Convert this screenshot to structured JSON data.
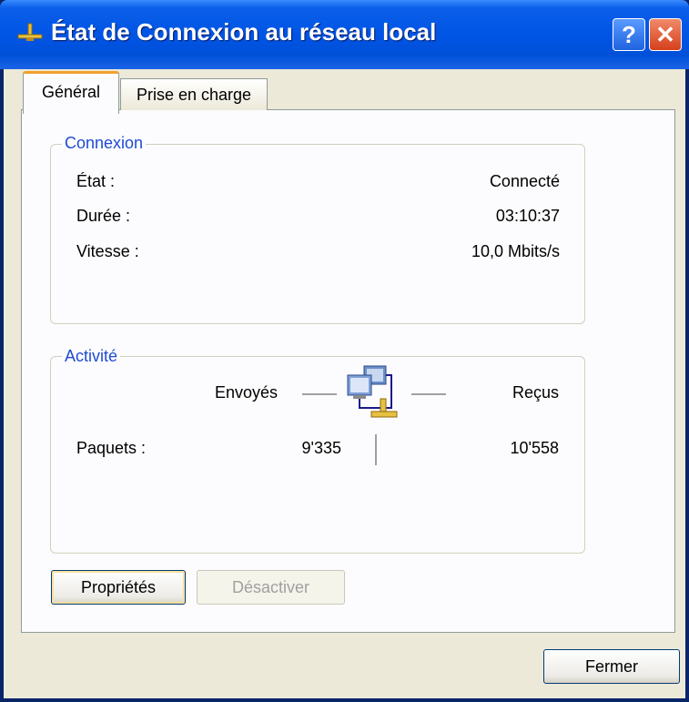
{
  "window": {
    "title": "État de Connexion au réseau local",
    "help_label": "?",
    "close_label": "✕"
  },
  "tabs": [
    {
      "label": "Général"
    },
    {
      "label": "Prise en charge"
    }
  ],
  "connexion": {
    "legend": "Connexion",
    "rows": [
      {
        "label": "État :",
        "value": "Connecté"
      },
      {
        "label": "Durée :",
        "value": "03:10:37"
      },
      {
        "label": "Vitesse :",
        "value": "10,0 Mbits/s"
      }
    ]
  },
  "activite": {
    "legend": "Activité",
    "sent_label": "Envoyés",
    "received_label": "Reçus",
    "packets_label": "Paquets :",
    "packets_sent": "9'335",
    "packets_received": "10'558",
    "icon": "network-computers-icon"
  },
  "buttons": {
    "properties": "Propriétés",
    "disable": "Désactiver",
    "close": "Fermer"
  },
  "colors": {
    "titlebar": "#0055e5",
    "client_bg": "#ece9d8",
    "group_legend": "#1f4bd0",
    "active_tab_accent": "#f0a030"
  }
}
